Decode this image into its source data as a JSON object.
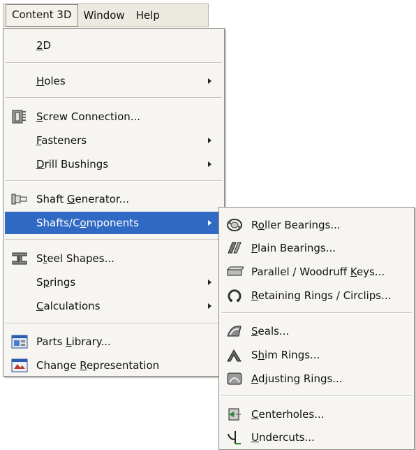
{
  "menubar": {
    "items": [
      "Content 3D",
      "Window",
      "Help"
    ]
  },
  "content3d_menu": {
    "items": [
      {
        "pre": "",
        "u": "2",
        "post": "D"
      },
      {
        "pre": "",
        "u": "H",
        "post": "oles"
      },
      {
        "pre": "",
        "u": "S",
        "post": "crew Connection..."
      },
      {
        "pre": "",
        "u": "F",
        "post": "asteners"
      },
      {
        "pre": "",
        "u": "D",
        "post": "rill Bushings"
      },
      {
        "pre": "Shaft ",
        "u": "G",
        "post": "enerator..."
      },
      {
        "pre": "Shafts/C",
        "u": "o",
        "post": "mponents"
      },
      {
        "pre": "S",
        "u": "t",
        "post": "eel Shapes..."
      },
      {
        "pre": "S",
        "u": "p",
        "post": "rings"
      },
      {
        "pre": "",
        "u": "C",
        "post": "alculations"
      },
      {
        "pre": "Parts ",
        "u": "L",
        "post": "ibrary..."
      },
      {
        "pre": "Change ",
        "u": "R",
        "post": "epresentation"
      }
    ]
  },
  "shafts_submenu": {
    "items": [
      {
        "pre": "R",
        "u": "o",
        "post": "ller Bearings..."
      },
      {
        "pre": "",
        "u": "P",
        "post": "lain Bearings..."
      },
      {
        "pre": "Parallel / Woodruff ",
        "u": "K",
        "post": "eys..."
      },
      {
        "pre": "",
        "u": "R",
        "post": "etaining Rings / Circlips..."
      },
      {
        "pre": "",
        "u": "S",
        "post": "eals..."
      },
      {
        "pre": "S",
        "u": "h",
        "post": "im Rings..."
      },
      {
        "pre": "",
        "u": "A",
        "post": "djusting Rings..."
      },
      {
        "pre": "",
        "u": "C",
        "post": "enterholes..."
      },
      {
        "pre": "",
        "u": "U",
        "post": "ndercuts..."
      }
    ]
  },
  "colors": {
    "highlight": "#316ac5",
    "menu_bg": "#f6f5f1",
    "menubar_bg": "#ece9e1"
  }
}
